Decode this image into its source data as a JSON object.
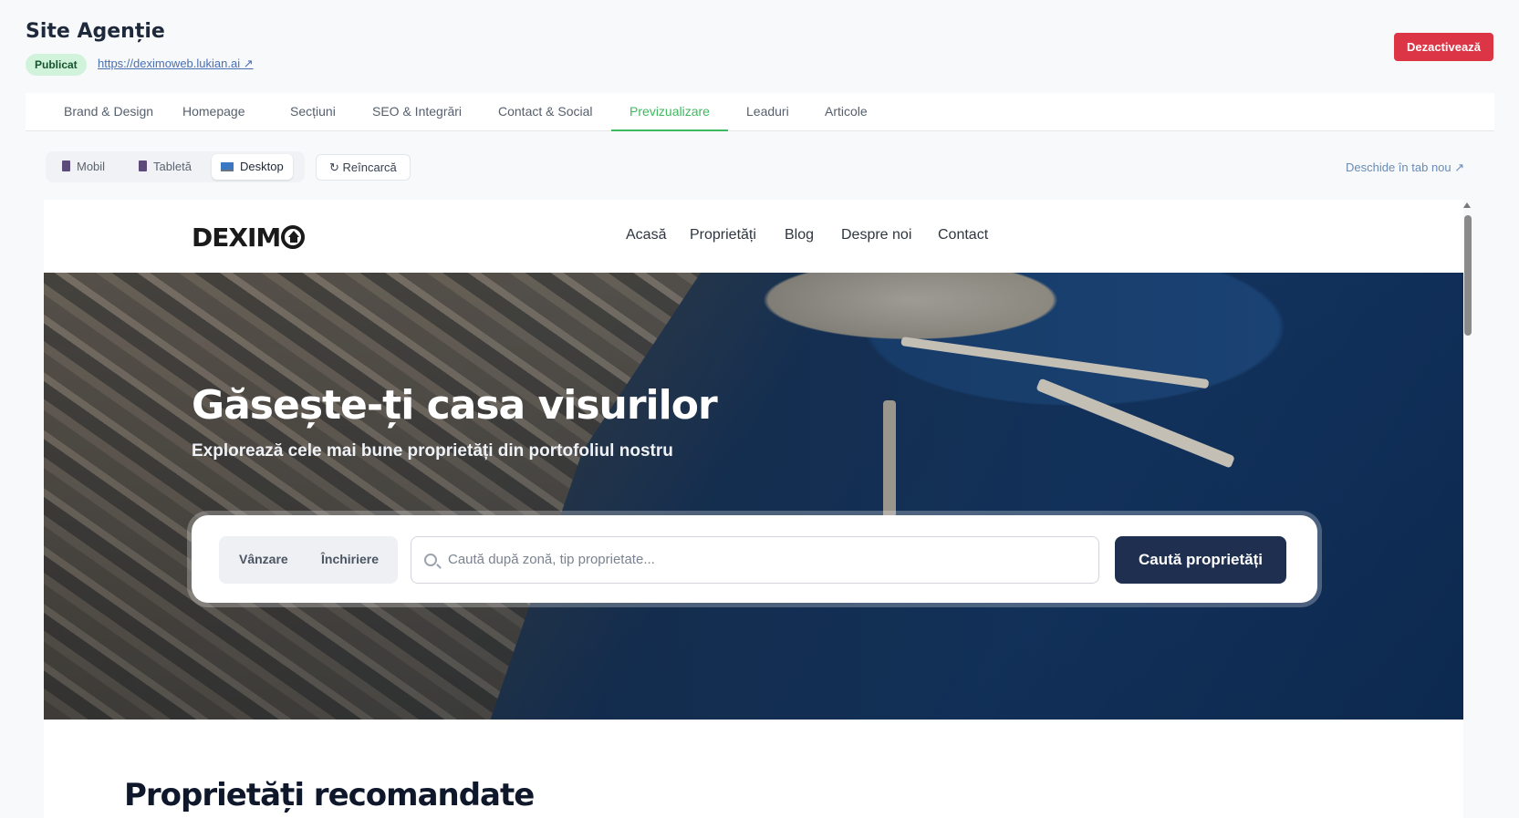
{
  "header": {
    "title": "Site Agenție",
    "status_badge": "Publicat",
    "site_url": "https://deximoweb.lukian.ai ↗",
    "deactivate_label": "Dezactivează"
  },
  "tabs": [
    {
      "label": "Brand & Design"
    },
    {
      "label": "Homepage"
    },
    {
      "label": "Secțiuni"
    },
    {
      "label": "SEO & Integrări"
    },
    {
      "label": "Contact & Social"
    },
    {
      "label": "Previzualizare",
      "active": true
    },
    {
      "label": "Leaduri"
    },
    {
      "label": "Articole"
    }
  ],
  "device_toolbar": {
    "mobile": "Mobil",
    "tablet": "Tabletă",
    "desktop": "Desktop",
    "selected": "Desktop",
    "reload": "↻ Reîncarcă",
    "open_new_tab": "Deschide în tab nou ↗"
  },
  "preview": {
    "logo_text": "DEXIMO",
    "nav": [
      "Acasă",
      "Proprietăți",
      "Blog",
      "Despre noi",
      "Contact"
    ],
    "hero": {
      "title": "Găsește-ți casa visurilor",
      "subtitle": "Explorează cele mai bune proprietăți din portofoliul nostru"
    },
    "search": {
      "sale_label": "Vânzare",
      "rent_label": "Închiriere",
      "placeholder": "Caută după zonă, tip proprietate...",
      "button_label": "Caută proprietăți"
    },
    "featured_title": "Proprietăți recomandate"
  },
  "colors": {
    "accent_green": "#3dba5e",
    "danger": "#dc3545",
    "navy": "#1e2f4f"
  },
  "icons": [
    "mobile-icon",
    "tablet-icon",
    "desktop-icon",
    "reload-icon",
    "external-link-icon",
    "search-icon"
  ]
}
